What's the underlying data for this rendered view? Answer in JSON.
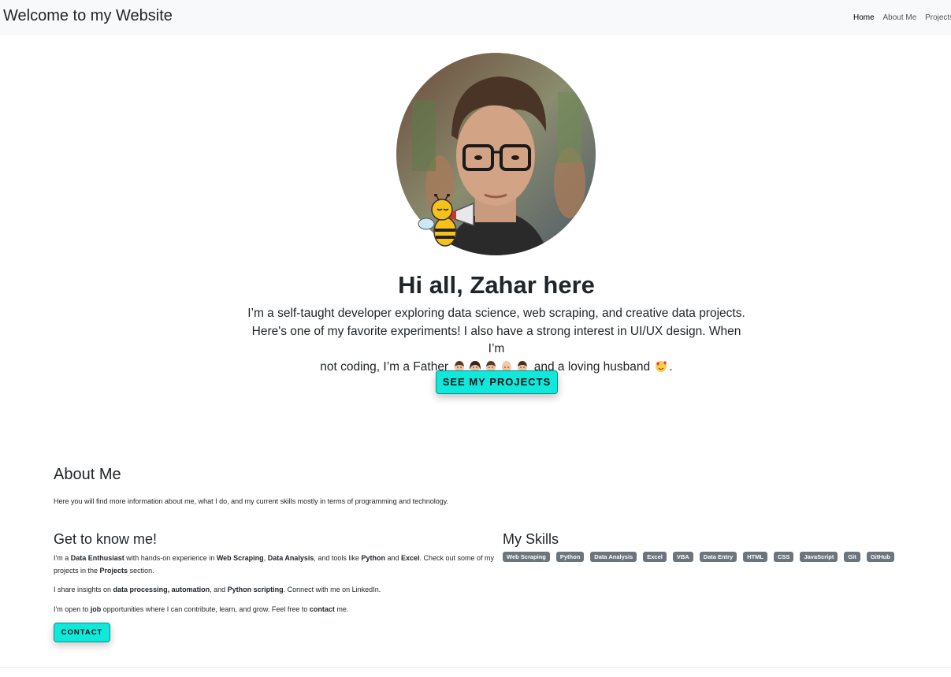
{
  "navbar": {
    "brand": "Welcome to my Website",
    "links": [
      {
        "label": "Home",
        "active": true
      },
      {
        "label": "About Me",
        "active": false
      },
      {
        "label": "Projects",
        "active": false
      }
    ]
  },
  "hero": {
    "title": "Hi all, Zahar here",
    "text_line1": "I’m a self-taught developer exploring data science, web scraping, and creative data projects.",
    "text_line2": "Here's one of my favorite experiments! I also have a strong interest in UI/UX design. When I’m",
    "text_line3_a": "not coding, I’m a Father",
    "text_line3_b": "and a loving husband",
    "text_line3_end": ".",
    "cta_label": "SEE MY PROJECTS"
  },
  "about": {
    "title": "About Me",
    "text": "Here you will find more information about me, what I do, and my current skills mostly in terms of programming and technology."
  },
  "know": {
    "title": "Get to know me!",
    "p1": [
      "I'm a ",
      "Data Enthusiast",
      " with hands-on experience in ",
      "Web Scraping",
      ", ",
      "Data Analysis",
      ", and tools like ",
      "Python",
      " and ",
      "Excel",
      ". Check out some of my projects in the ",
      "Projects",
      " section."
    ],
    "p2": [
      "I share insights on ",
      "data processing, automation",
      ", and ",
      "Python scripting",
      ". Connect with me on LinkedIn."
    ],
    "p3": [
      "I'm open to ",
      "job",
      " opportunities where I can contribute, learn, and grow. Feel free to ",
      "contact",
      " me."
    ],
    "contact_label": "CONTACT"
  },
  "skills": {
    "title": "My Skills",
    "items": [
      "Web Scraping",
      "Python",
      "Data Analysis",
      "Excel",
      "VBA",
      "Data Entry",
      "HTML",
      "CSS",
      "JavaScript",
      "Git",
      "GitHub"
    ]
  },
  "colors": {
    "accent": "#11e8dc",
    "badge": "#6c757d",
    "navbar_bg": "#f8f9fa"
  },
  "icons": {
    "avatar": "profile-photo",
    "bee": "bee-megaphone-sticker",
    "family": [
      "boy-face",
      "girl-face",
      "boy-face",
      "baby-face",
      "man-face"
    ],
    "love": "smiling-face-with-hearts"
  }
}
